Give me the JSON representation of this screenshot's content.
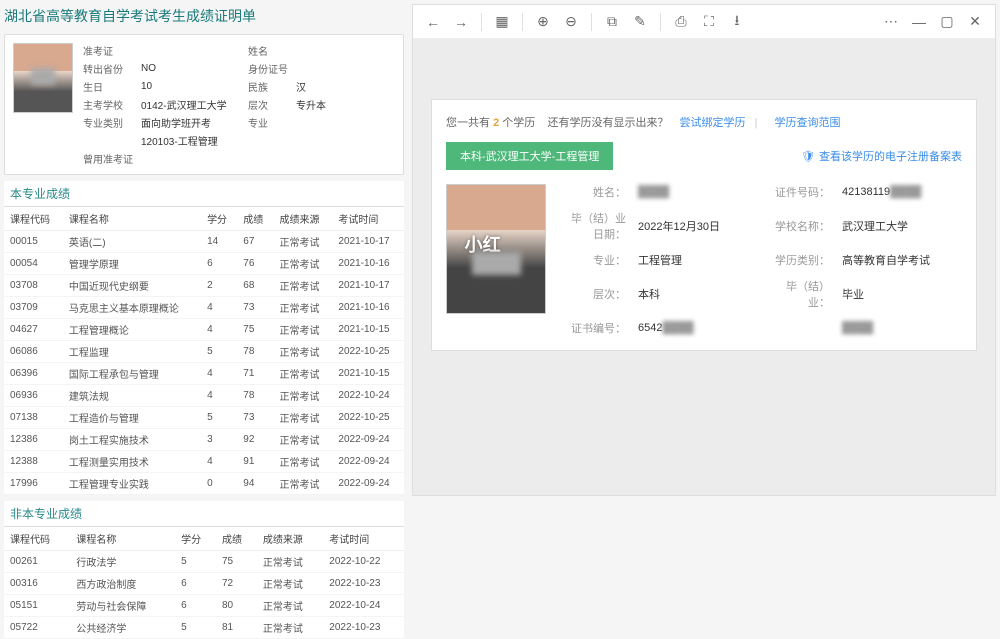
{
  "left": {
    "title": "湖北省高等教育自学考试考生成绩证明单",
    "info": {
      "r1": [
        "准考证",
        "",
        "姓名",
        "",
        "转出省份",
        "NO"
      ],
      "r2": [
        "身份证号",
        "",
        "生日",
        "10",
        "民族",
        "汉"
      ],
      "r3": [
        "主考学校",
        "0142-武汉理工大学",
        "层次",
        "专升本",
        "专业类别",
        "面向助学班开考"
      ],
      "r4": [
        "专业",
        "120103-工程管理"
      ],
      "r5": [
        "曾用准考证",
        ""
      ]
    },
    "sec1": "本专业成绩",
    "cols": [
      "课程代码",
      "课程名称",
      "学分",
      "成绩",
      "成绩来源",
      "考试时间"
    ],
    "rows1": [
      [
        "00015",
        "英语(二)",
        "14",
        "67",
        "正常考试",
        "2021-10-17"
      ],
      [
        "00054",
        "管理学原理",
        "6",
        "76",
        "正常考试",
        "2021-10-16"
      ],
      [
        "03708",
        "中国近现代史纲要",
        "2",
        "68",
        "正常考试",
        "2021-10-17"
      ],
      [
        "03709",
        "马克思主义基本原理概论",
        "4",
        "73",
        "正常考试",
        "2021-10-16"
      ],
      [
        "04627",
        "工程管理概论",
        "4",
        "75",
        "正常考试",
        "2021-10-15"
      ],
      [
        "06086",
        "工程监理",
        "5",
        "78",
        "正常考试",
        "2022-10-25"
      ],
      [
        "06396",
        "国际工程承包与管理",
        "4",
        "71",
        "正常考试",
        "2021-10-15"
      ],
      [
        "06936",
        "建筑法规",
        "4",
        "78",
        "正常考试",
        "2022-10-24"
      ],
      [
        "07138",
        "工程造价与管理",
        "5",
        "73",
        "正常考试",
        "2022-10-25"
      ],
      [
        "12386",
        "岗土工程实施技术",
        "3",
        "92",
        "正常考试",
        "2022-09-24"
      ],
      [
        "12388",
        "工程测量实用技术",
        "4",
        "91",
        "正常考试",
        "2022-09-24"
      ],
      [
        "17996",
        "工程管理专业实践",
        "0",
        "94",
        "正常考试",
        "2022-09-24"
      ]
    ],
    "sec2": "非本专业成绩",
    "rows2": [
      [
        "00261",
        "行政法学",
        "5",
        "75",
        "正常考试",
        "2022-10-22"
      ],
      [
        "00316",
        "西方政治制度",
        "6",
        "72",
        "正常考试",
        "2022-10-23"
      ],
      [
        "05151",
        "劳动与社会保障",
        "6",
        "80",
        "正常考试",
        "2022-10-24"
      ],
      [
        "05722",
        "公共经济学",
        "5",
        "81",
        "正常考试",
        "2022-10-23"
      ]
    ]
  },
  "right": {
    "summary": {
      "pre": "您一共有",
      "num": "2",
      "suf": "个学历",
      "q": "还有学历没有显示出来？",
      "a1": "尝试绑定学历",
      "a2": "学历查询范围"
    },
    "tag": "本科-武汉理工大学-工程管理",
    "reg": "查看该学历的电子注册备案表",
    "fields": [
      [
        "姓名：",
        "",
        "证件号码：",
        "42138119"
      ],
      [
        "毕（结）业日期：",
        "2022年12月30日",
        "学校名称：",
        "武汉理工大学"
      ],
      [
        "专业：",
        "工程管理",
        "学历类别：",
        "高等教育自学考试"
      ],
      [
        "层次：",
        "本科",
        "毕（结）业：",
        "毕业"
      ],
      [
        "证书编号：",
        "6542",
        "",
        ""
      ]
    ]
  }
}
